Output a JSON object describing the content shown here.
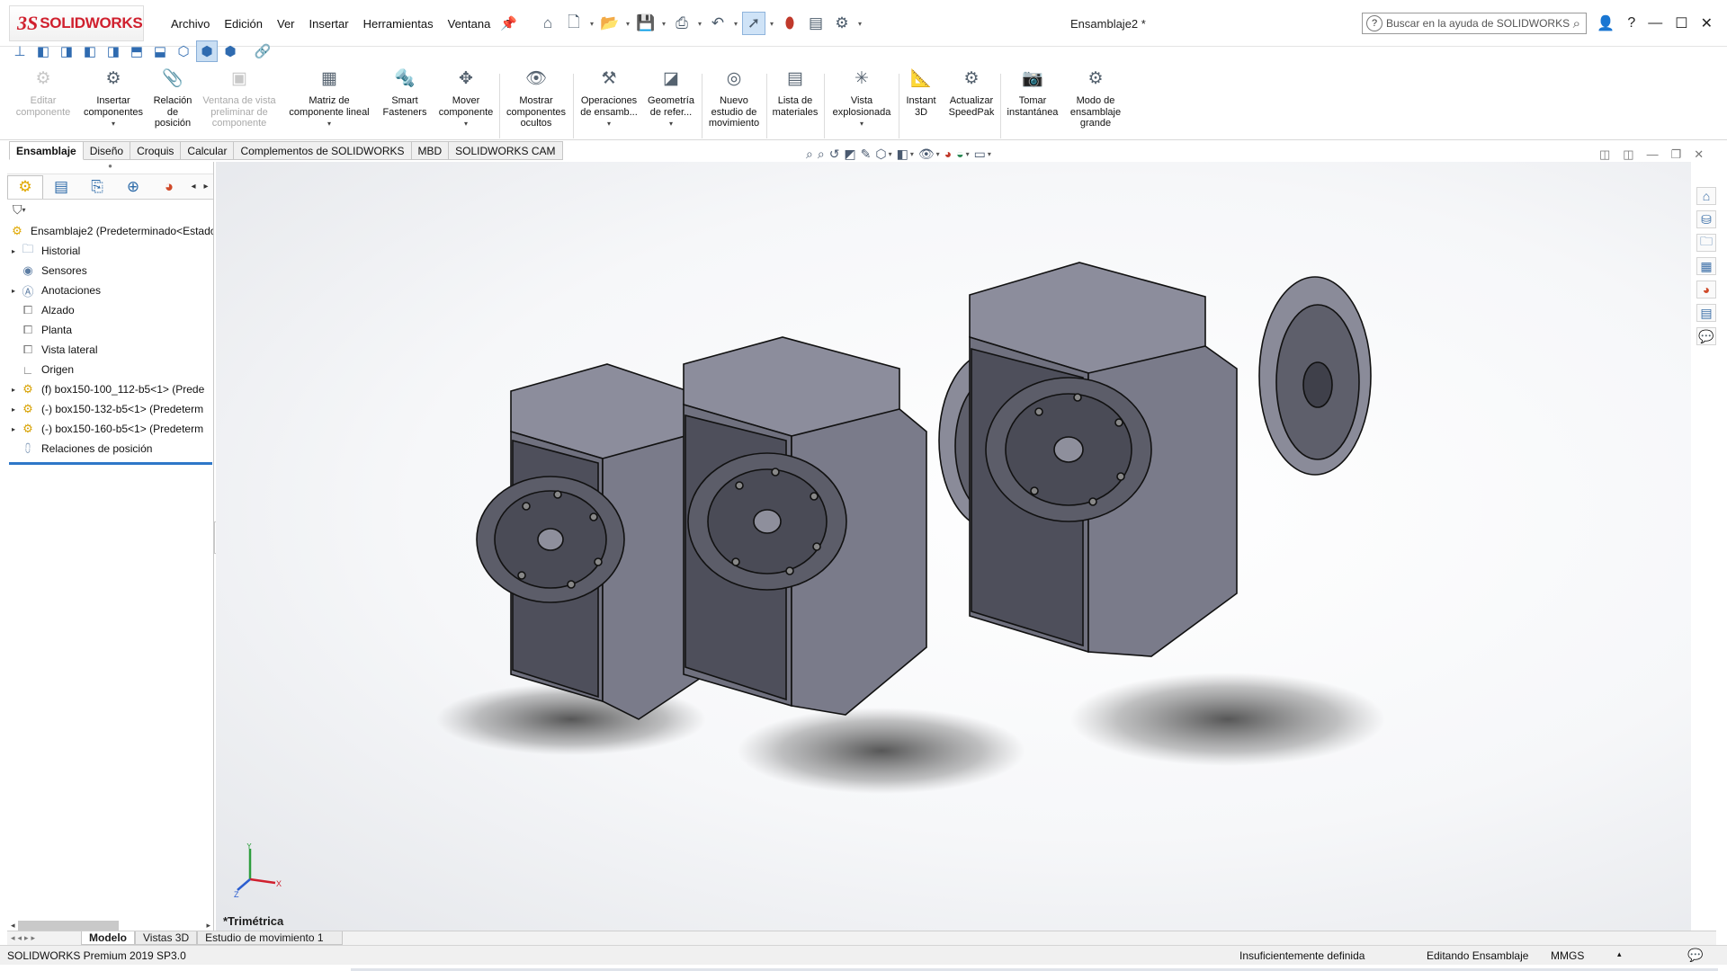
{
  "app": {
    "logo_prefix": "3S",
    "logo_text": "SOLIDWORKS",
    "doc_title": "Ensamblaje2 *"
  },
  "menu": [
    "Archivo",
    "Edición",
    "Ver",
    "Insertar",
    "Herramientas",
    "Ventana",
    "?"
  ],
  "search": {
    "placeholder": "Buscar en la ayuda de SOLIDWORKS"
  },
  "commands": [
    {
      "label": "Editar componente",
      "enabled": false
    },
    {
      "label": "Insertar componentes",
      "enabled": true
    },
    {
      "label": "Relación de posición",
      "enabled": true
    },
    {
      "label": "Ventana de vista preliminar de componente",
      "enabled": false
    },
    {
      "label": "Matriz de componente lineal",
      "enabled": true
    },
    {
      "label": "Smart Fasteners",
      "enabled": true
    },
    {
      "label": "Mover componente",
      "enabled": true
    },
    {
      "label": "Mostrar componentes ocultos",
      "enabled": true
    },
    {
      "label": "Operaciones de ensamb...",
      "enabled": true
    },
    {
      "label": "Geometría de refer...",
      "enabled": true
    },
    {
      "label": "Nuevo estudio de movimiento",
      "enabled": true
    },
    {
      "label": "Lista de materiales",
      "enabled": true
    },
    {
      "label": "Vista explosionada",
      "enabled": true
    },
    {
      "label": "Instant 3D",
      "enabled": true
    },
    {
      "label": "Actualizar SpeedPak",
      "enabled": true
    },
    {
      "label": "Tomar instantánea",
      "enabled": true
    },
    {
      "label": "Modo de ensamblaje grande",
      "enabled": true
    }
  ],
  "tabs": [
    "Ensamblaje",
    "Diseño",
    "Croquis",
    "Calcular",
    "Complementos de SOLIDWORKS",
    "MBD",
    "SOLIDWORKS CAM"
  ],
  "active_tab": "Ensamblaje",
  "tree": {
    "root": "Ensamblaje2  (Predeterminado<Estado",
    "items": [
      {
        "label": "Historial",
        "icon": "folder-icon",
        "expandable": true
      },
      {
        "label": "Sensores",
        "icon": "sensor-icon",
        "expandable": false
      },
      {
        "label": "Anotaciones",
        "icon": "annotation-icon",
        "expandable": true
      },
      {
        "label": "Alzado",
        "icon": "plane-icon",
        "expandable": false
      },
      {
        "label": "Planta",
        "icon": "plane-icon",
        "expandable": false
      },
      {
        "label": "Vista lateral",
        "icon": "plane-icon",
        "expandable": false
      },
      {
        "label": "Origen",
        "icon": "origin-icon",
        "expandable": false
      },
      {
        "label": "(f) box150-100_112-b5<1> (Prede",
        "icon": "part-icon",
        "expandable": true
      },
      {
        "label": "(-) box150-132-b5<1> (Predeterm",
        "icon": "part-icon",
        "expandable": true
      },
      {
        "label": "(-) box150-160-b5<1> (Predeterm",
        "icon": "part-icon",
        "expandable": true
      },
      {
        "label": "Relaciones de posición",
        "icon": "mate-icon",
        "expandable": false
      }
    ]
  },
  "viewport": {
    "view_name": "*Trimétrica"
  },
  "bottom_tabs": [
    "Modelo",
    "Vistas 3D",
    "Estudio de movimiento 1"
  ],
  "active_bottom_tab": "Modelo",
  "status": {
    "version": "SOLIDWORKS Premium 2019 SP3.0",
    "definition": "Insuficientemente definida",
    "mode": "Editando Ensamblaje",
    "units": "MMGS"
  },
  "colors": {
    "brand": "#d0202e",
    "accent": "#2e77c8",
    "part_gray": "#6f7080"
  }
}
